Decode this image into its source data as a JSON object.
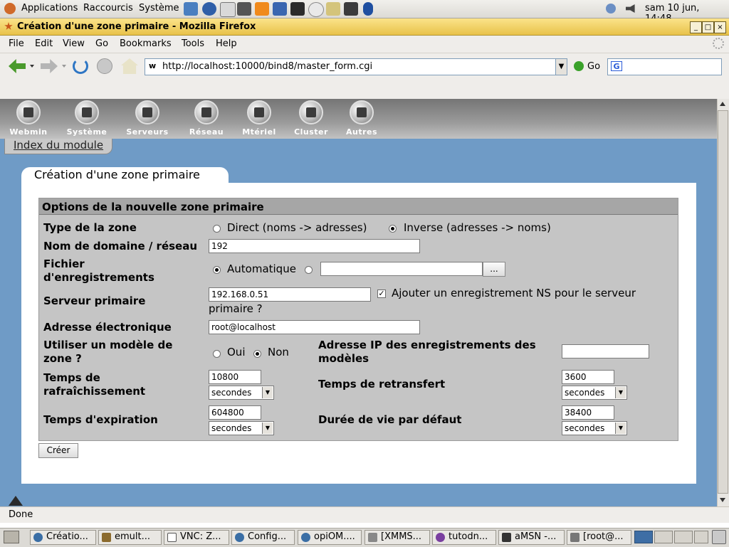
{
  "top_panel": {
    "menus": [
      "Applications",
      "Raccourcis",
      "Système"
    ],
    "clock": "sam 10 jun, 14:48"
  },
  "window": {
    "title": "Création d'une zone primaire - Mozilla Firefox",
    "controls": [
      "_",
      "□",
      "×"
    ]
  },
  "firefox": {
    "menu": [
      "File",
      "Edit",
      "View",
      "Go",
      "Bookmarks",
      "Tools",
      "Help"
    ],
    "url": "http://localhost:10000/bind8/master_form.cgi",
    "go_label": "Go",
    "status": "Done"
  },
  "webmin": {
    "categories": [
      "Webmin",
      "Système",
      "Serveurs",
      "Réseau",
      "Mtériel",
      "Cluster",
      "Autres"
    ],
    "module_index": "Index du module",
    "page_title": "Création d'une zone primaire"
  },
  "form": {
    "section_title": "Options de la nouvelle zone primaire",
    "zone_type_label": "Type de la zone",
    "zone_type_options": [
      "Direct (noms -> adresses)",
      "Inverse (adresses -> noms)"
    ],
    "zone_type_selected": "Inverse (adresses -> noms)",
    "domain_label": "Nom de domaine / réseau",
    "domain_value": "192",
    "records_file_label_1": "Fichier",
    "records_file_label_2": "d'enregistrements",
    "records_file_auto": "Automatique",
    "browse_button": "...",
    "master_server_label": "Serveur primaire",
    "master_server_value": "192.168.0.51",
    "ns_checkbox_label_1": "Ajouter un enregistrement NS pour le serveur",
    "ns_checkbox_label_2": "primaire ?",
    "ns_checked": true,
    "email_label": "Adresse électronique",
    "email_value": "root@localhost",
    "template_label_1": "Utiliser un modèle de",
    "template_label_2": "zone ?",
    "template_yes": "Oui",
    "template_no": "Non",
    "template_selected": "Non",
    "template_ip_label_1": "Adresse IP des enregistrements des",
    "template_ip_label_2": "modèles",
    "refresh_label_1": "Temps de",
    "refresh_label_2": "rafraîchissement",
    "refresh_value": "10800",
    "refresh_unit": "secondes",
    "retry_label": "Temps de retransfert",
    "retry_value": "3600",
    "retry_unit": "secondes",
    "expire_label": "Temps d'expiration",
    "expire_value": "604800",
    "expire_unit": "secondes",
    "ttl_label": "Durée de vie par défaut",
    "ttl_value": "38400",
    "ttl_unit": "secondes",
    "create_button": "Créer"
  },
  "taskbar": [
    {
      "label": "Créatio...",
      "color": "#3a6ea5"
    },
    {
      "label": "emult...",
      "color": "#8b6b2e"
    },
    {
      "label": "VNC: Z...",
      "color": "#555555"
    },
    {
      "label": "Config...",
      "color": "#3a6ea5"
    },
    {
      "label": "opiOM....",
      "color": "#3a6ea5"
    },
    {
      "label": "[XMMS...",
      "color": "#888888"
    },
    {
      "label": "tutodn...",
      "color": "#7a3fa0"
    },
    {
      "label": "aMSN -...",
      "color": "#333333"
    },
    {
      "label": "[root@...",
      "color": "#777777"
    }
  ]
}
